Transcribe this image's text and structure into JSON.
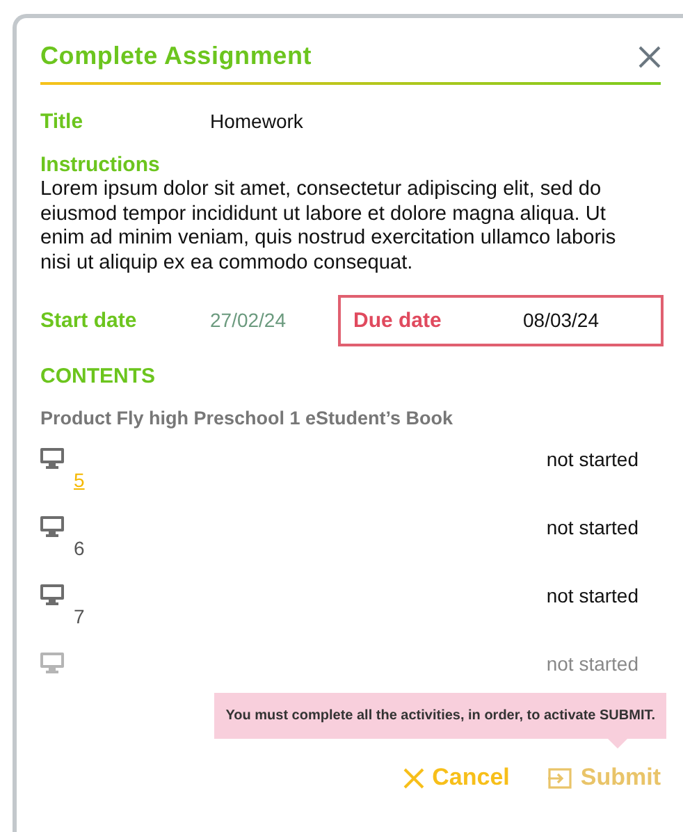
{
  "dialog": {
    "title": "Complete Assignment"
  },
  "title_field": {
    "label": "Title",
    "value": "Homework"
  },
  "instructions": {
    "label": "Instructions",
    "text": "Lorem ipsum dolor sit amet, consectetur adipiscing elit, sed do eiusmod tempor incididunt ut labore et dolore magna aliqua. Ut enim ad minim veniam, quis nostrud exercitation ullamco laboris nisi ut aliquip ex ea commodo consequat."
  },
  "start_date": {
    "label": "Start date",
    "value": "27/02/24"
  },
  "due_date": {
    "label": "Due date",
    "value": "08/03/24"
  },
  "contents": {
    "heading": "CONTENTS",
    "product": "Product Fly high Preschool 1 eStudent’s Book",
    "items": [
      {
        "kind": "link",
        "number": "5",
        "status": "not started"
      },
      {
        "kind": "text",
        "number": "6",
        "status": "not started"
      },
      {
        "kind": "text",
        "number": "7",
        "status": "not started"
      },
      {
        "status": "not started"
      }
    ]
  },
  "tooltip": "You must complete all the activities, in order, to activate SUBMIT.",
  "buttons": [
    {
      "kind": "cancel",
      "label": "Cancel",
      "disabled": false
    },
    {
      "kind": "submit",
      "label": "Submit",
      "disabled": true
    }
  ]
}
